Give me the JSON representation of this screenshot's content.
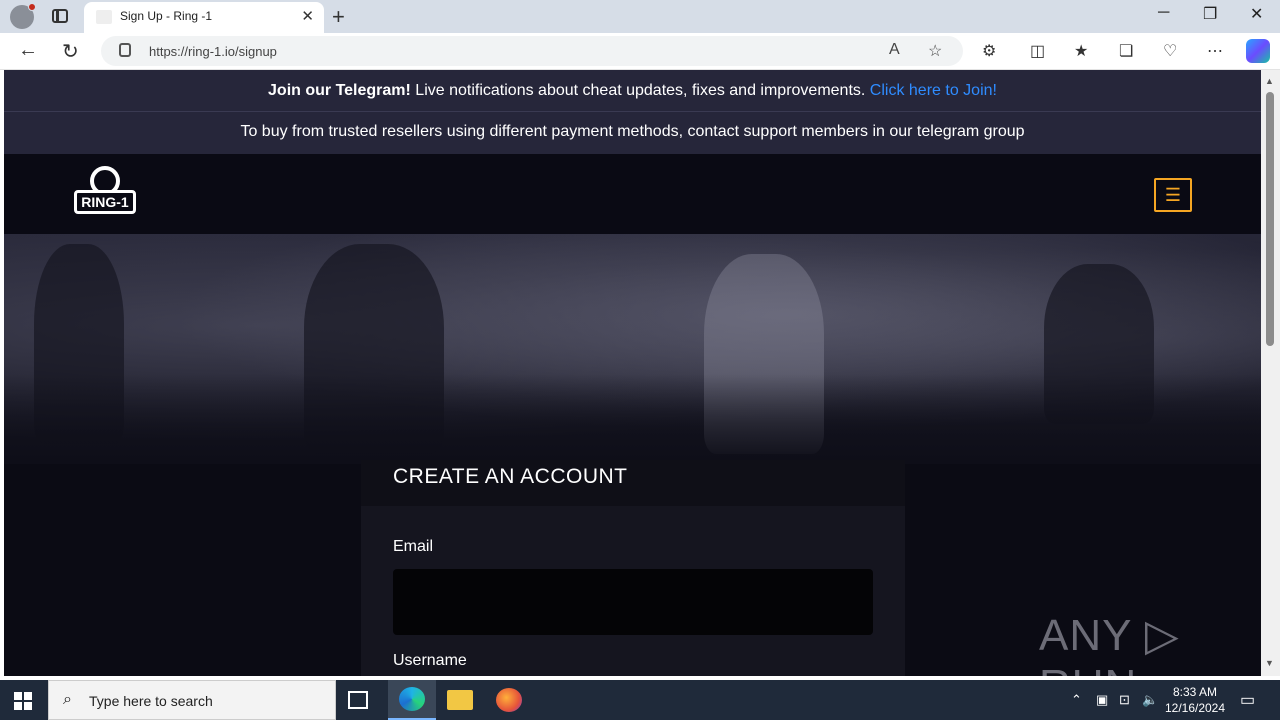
{
  "browser": {
    "tab_title": "Sign Up - Ring -1",
    "url": "https://ring-1.io/signup",
    "new_tab_label": "+"
  },
  "page": {
    "banner1": {
      "bold": "Join our Telegram!",
      "text": " Live notifications about cheat updates, fixes and improvements. ",
      "link": "Click here to Join!",
      "link_color": "#2f8cff"
    },
    "banner2": "To buy from trusted resellers using different payment methods, contact support members in our telegram group",
    "logo_text": "RING-1",
    "menu_icon": "☰",
    "form": {
      "title": "CREATE AN ACCOUNT",
      "email_label": "Email",
      "email_value": "",
      "username_label": "Username"
    },
    "accent_color": "#f5a623"
  },
  "watermark": "ANY ▷ RUN",
  "taskbar": {
    "search_placeholder": "Type here to search",
    "time": "8:33 AM",
    "date": "12/16/2024"
  }
}
